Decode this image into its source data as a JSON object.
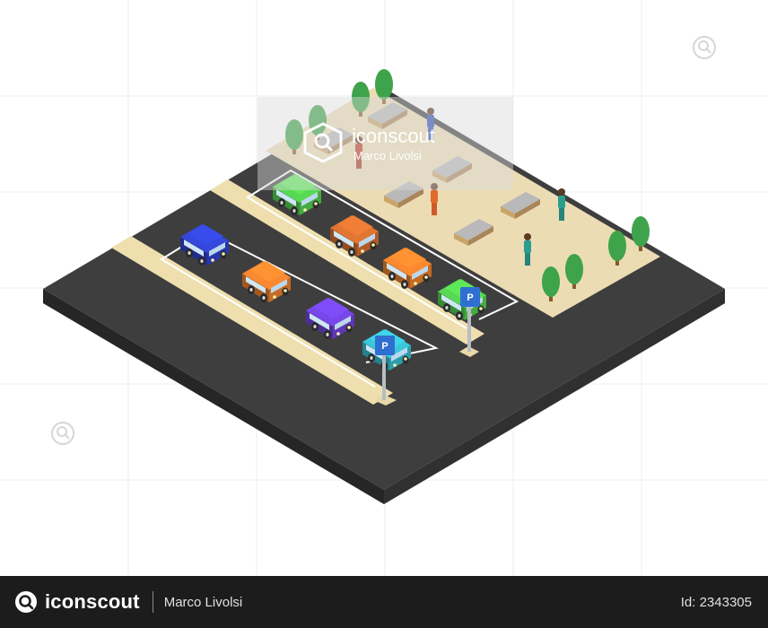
{
  "watermark": {
    "brand": "iconscout",
    "author": "Marco Livolsi"
  },
  "parking_sign_letter": "P",
  "footer": {
    "brand": "iconscout",
    "author": "Marco Livolsi",
    "asset_id": "Id: 2343305"
  },
  "icons": {
    "watermark_logo": "iconscout-search-logo-icon",
    "footer_logo": "iconscout-logo-icon"
  },
  "colors": {
    "asphalt": "#3e3e3e",
    "plaza": "#ecdcb4",
    "lane_stripe": "#efdfae",
    "footer_bg": "#1c1c1c",
    "tree": "#3ea34a",
    "sign": "#2f6fd1"
  },
  "cars": [
    {
      "name": "blue-car",
      "color": "#2f3fc4"
    },
    {
      "name": "orange-car-back-left",
      "color": "#e07a2a"
    },
    {
      "name": "green-car-back",
      "color": "#4ec24a"
    },
    {
      "name": "brown-car",
      "color": "#c9692d"
    },
    {
      "name": "orange-car-back-right",
      "color": "#e07a2a"
    },
    {
      "name": "purple-car",
      "color": "#6b3fd0"
    },
    {
      "name": "green-car-front",
      "color": "#4ec24a"
    },
    {
      "name": "teal-car",
      "color": "#33b3c2"
    }
  ]
}
